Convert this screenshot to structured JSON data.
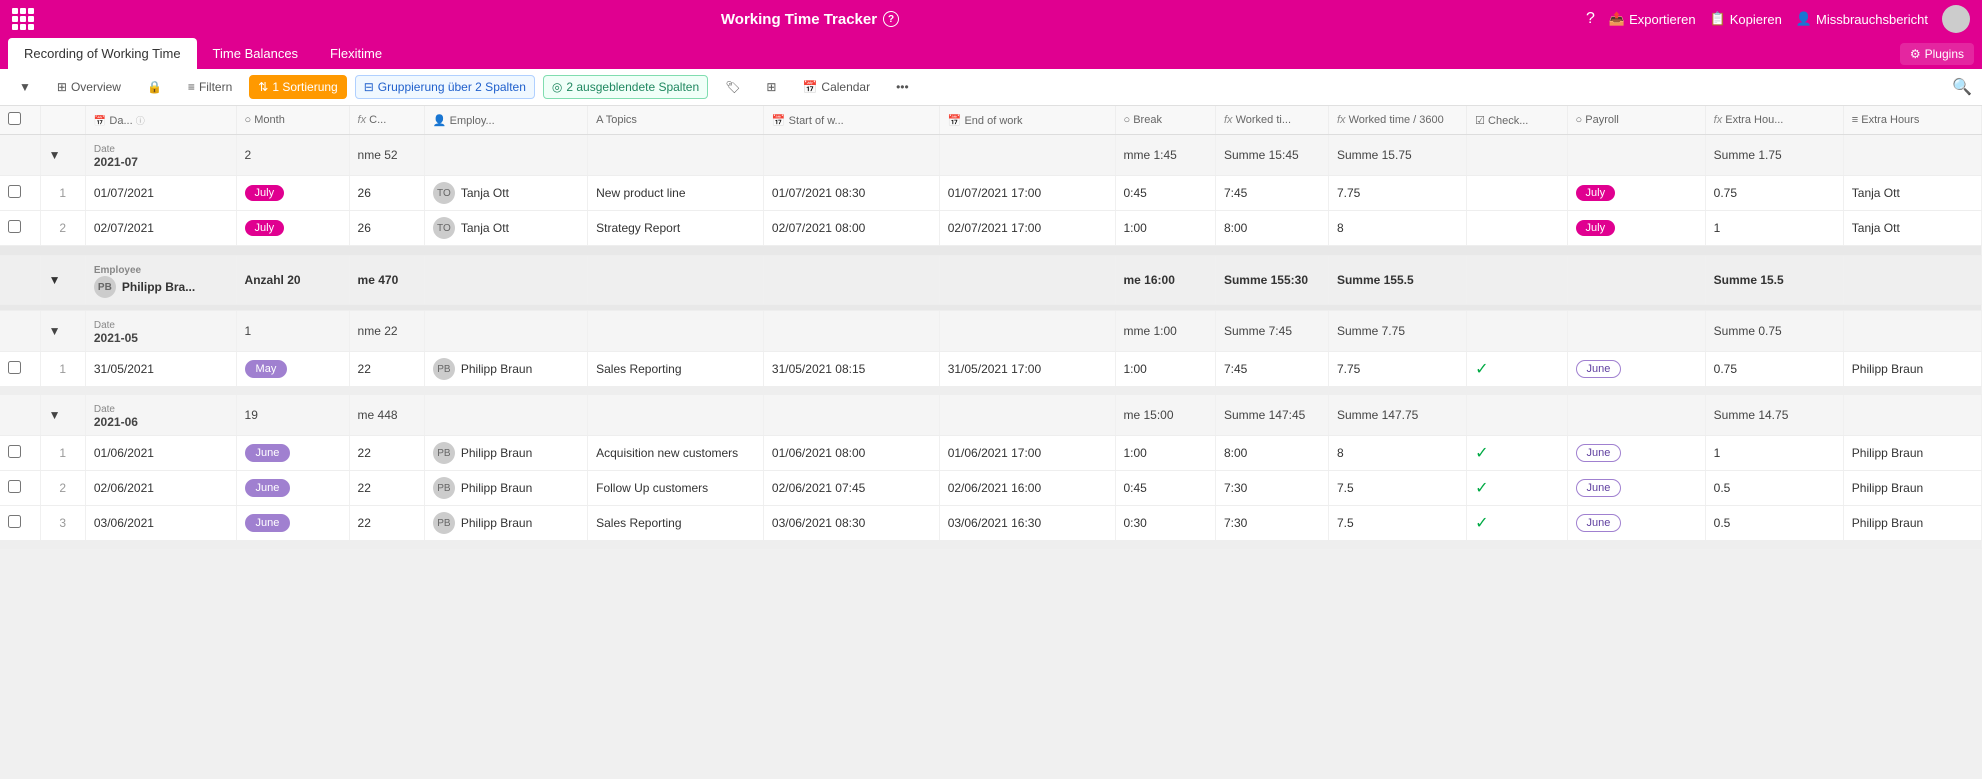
{
  "app": {
    "title": "Working Time Tracker",
    "top_actions": {
      "export": "Exportieren",
      "copy": "Kopieren",
      "report": "Missbrauchsbericht"
    },
    "tabs": [
      {
        "label": "Recording of Working Time",
        "active": true
      },
      {
        "label": "Time Balances",
        "active": false
      },
      {
        "label": "Flexitime",
        "active": false
      }
    ],
    "plugins_label": "Plugins"
  },
  "toolbar": {
    "overview": "Overview",
    "filter": "Filtern",
    "sort": "1 Sortierung",
    "group": "Gruppierung über 2 Spalten",
    "hidden": "2 ausgeblendete Spalten",
    "calendar": "Calendar"
  },
  "table": {
    "headers": [
      {
        "label": "",
        "icon": "checkbox"
      },
      {
        "label": ""
      },
      {
        "label": "Da...",
        "icon": "calendar"
      },
      {
        "label": "Month"
      },
      {
        "label": "C...",
        "icon": "fx"
      },
      {
        "label": "Employ...",
        "icon": "person"
      },
      {
        "label": "Topics",
        "icon": "text"
      },
      {
        "label": "Start of w...",
        "icon": "calendar"
      },
      {
        "label": "End of work",
        "icon": "calendar"
      },
      {
        "label": "Break",
        "icon": "circle"
      },
      {
        "label": "Worked ti...",
        "icon": "fx"
      },
      {
        "label": "Worked time / 3600",
        "icon": "fx"
      },
      {
        "label": "Check...",
        "icon": "checkbox"
      },
      {
        "label": "Payroll",
        "icon": "circle"
      },
      {
        "label": "Extra Hou...",
        "icon": "fx"
      },
      {
        "label": "Extra Hours",
        "icon": "list"
      }
    ],
    "groups": [
      {
        "type": "date_group",
        "label": "Date",
        "value": "2021-07",
        "count": 2,
        "c_sum": "nme 52",
        "break_sum": "mme 1:45",
        "worked_sum": "Summe 15:45",
        "worked3600_sum": "Summe 15.75",
        "extra_sum": "Summe 1.75",
        "rows": [
          {
            "num": 1,
            "date": "01/07/2021",
            "month_badge": "July",
            "month_badge_type": "july",
            "c_val": "26",
            "employee": "Tanja Ott",
            "employee_avatar": "TO",
            "topics": "New product line",
            "start": "01/07/2021 08:30",
            "end": "01/07/2021 17:00",
            "break": "0:45",
            "worked": "7:45",
            "worked3600": "7.75",
            "check": "",
            "payroll_badge": "July",
            "payroll_badge_type": "july",
            "extra1": "0.75",
            "extra2": "Tanja Ott"
          },
          {
            "num": 2,
            "date": "02/07/2021",
            "month_badge": "July",
            "month_badge_type": "july",
            "c_val": "26",
            "employee": "Tanja Ott",
            "employee_avatar": "TO",
            "topics": "Strategy Report",
            "start": "02/07/2021 08:00",
            "end": "02/07/2021 17:00",
            "break": "1:00",
            "worked": "8:00",
            "worked3600": "8",
            "check": "",
            "payroll_badge": "July",
            "payroll_badge_type": "july",
            "extra1": "1",
            "extra2": "Tanja Ott"
          }
        ]
      },
      {
        "type": "employee_group",
        "label": "Employee",
        "value": "Philipp Bra...",
        "count": 20,
        "c_sum": "me 470",
        "break_sum": "me 16:00",
        "worked_sum": "Summe 155:30",
        "worked3600_sum": "Summe 155.5",
        "extra_sum": "Summe 15.5",
        "sub_groups": [
          {
            "type": "date_group",
            "label": "Date",
            "value": "2021-05",
            "count": 1,
            "c_sum": "nme 22",
            "break_sum": "mme 1:00",
            "worked_sum": "Summe 7:45",
            "worked3600_sum": "Summe 7.75",
            "extra_sum": "Summe 0.75",
            "rows": [
              {
                "num": 1,
                "date": "31/05/2021",
                "month_badge": "May",
                "month_badge_type": "may",
                "c_val": "22",
                "employee": "Philipp Braun",
                "employee_avatar": "PB",
                "topics": "Sales Reporting",
                "start": "31/05/2021 08:15",
                "end": "31/05/2021 17:00",
                "break": "1:00",
                "worked": "7:45",
                "worked3600": "7.75",
                "check": "✓",
                "payroll_badge": "June",
                "payroll_badge_type": "june_outline",
                "extra1": "0.75",
                "extra2": "Philipp Braun"
              }
            ]
          },
          {
            "type": "date_group",
            "label": "Date",
            "value": "2021-06",
            "count": 19,
            "c_sum": "me 448",
            "break_sum": "me 15:00",
            "worked_sum": "Summe 147:45",
            "worked3600_sum": "Summe 147.75",
            "extra_sum": "Summe 14.75",
            "rows": [
              {
                "num": 1,
                "date": "01/06/2021",
                "month_badge": "June",
                "month_badge_type": "june_solid",
                "c_val": "22",
                "employee": "Philipp Braun",
                "employee_avatar": "PB",
                "topics": "Acquisition new customers",
                "start": "01/06/2021 08:00",
                "end": "01/06/2021 17:00",
                "break": "1:00",
                "worked": "8:00",
                "worked3600": "8",
                "check": "✓",
                "payroll_badge": "June",
                "payroll_badge_type": "june_outline",
                "extra1": "1",
                "extra2": "Philipp Braun"
              },
              {
                "num": 2,
                "date": "02/06/2021",
                "month_badge": "June",
                "month_badge_type": "june_solid",
                "c_val": "22",
                "employee": "Philipp Braun",
                "employee_avatar": "PB",
                "topics": "Follow Up customers",
                "start": "02/06/2021 07:45",
                "end": "02/06/2021 16:00",
                "break": "0:45",
                "worked": "7:30",
                "worked3600": "7.5",
                "check": "✓",
                "payroll_badge": "June",
                "payroll_badge_type": "june_outline",
                "extra1": "0.5",
                "extra2": "Philipp Braun"
              },
              {
                "num": 3,
                "date": "03/06/2021",
                "month_badge": "June",
                "month_badge_type": "june_solid",
                "c_val": "22",
                "employee": "Philipp Braun",
                "employee_avatar": "PB",
                "topics": "Sales Reporting",
                "start": "03/06/2021 08:30",
                "end": "03/06/2021 16:30",
                "break": "0:30",
                "worked": "7:30",
                "worked3600": "7.5",
                "check": "✓",
                "payroll_badge": "June",
                "payroll_badge_type": "june_outline",
                "extra1": "0.5",
                "extra2": "Philipp Braun"
              }
            ]
          }
        ]
      }
    ]
  }
}
